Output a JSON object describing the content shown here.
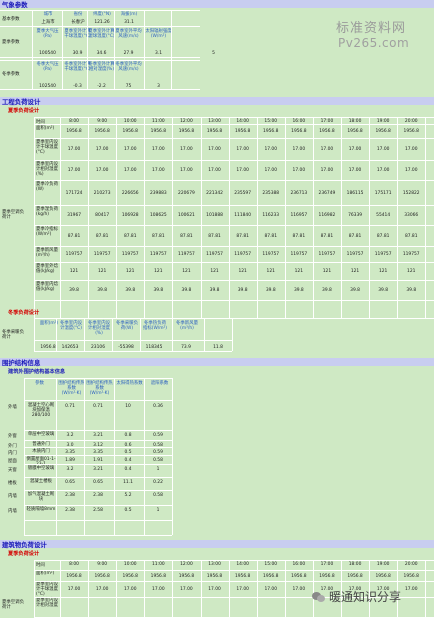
{
  "watermark": {
    "line1": "标准资料网",
    "line2": "Pv265.com"
  },
  "weather": {
    "title": "气象参数",
    "basic_label": "基本参数",
    "basic_headers": [
      "城市",
      "省份",
      "纬度(°N)",
      "海拔(m)"
    ],
    "basic_values": [
      "上海市",
      "长春沪",
      "121.26",
      "31.1"
    ],
    "summer_label": "夏季参数",
    "summer_headers": [
      "夏季大气压(Pa)",
      "夏季室外计算干球温度(°C)",
      "夏季室外计算湿球温度(°C)",
      "夏季室外平均风速(m/s)",
      "太阳辐射强度(W/m²)"
    ],
    "summer_values": [
      "100540",
      "30.9",
      "34.6",
      "27.9",
      "3.1",
      "5"
    ],
    "winter_label": "冬季参数",
    "winter_headers": [
      "冬季大气压(Pa)",
      "冬季室外计算干球温度(°C)",
      "冬季室外计算相对湿度(%)",
      "冬季室外平均风速(m/s)"
    ],
    "winter_values": [
      "102540",
      "-0.3",
      "-2.2",
      "75",
      "3"
    ]
  },
  "engineering": {
    "title": "工程负荷设计",
    "summer_sub": "夏季负荷设计",
    "time_label": "时间",
    "hours": [
      "8:00",
      "9:00",
      "10:00",
      "11:00",
      "12:00",
      "13:00",
      "14:00",
      "15:00",
      "16:00",
      "17:00",
      "18:00",
      "19:00",
      "20:00"
    ],
    "group_label": "夏季空调负荷计",
    "rows": [
      {
        "label": "面积(m²)",
        "values": [
          "1956.8",
          "1956.8",
          "1956.8",
          "1956.8",
          "1956.8",
          "1956.8",
          "1956.8",
          "1956.8",
          "1956.8",
          "1956.8",
          "1956.8",
          "1956.8",
          "1956.8"
        ]
      },
      {
        "label": "夏季室内设计干球温度(°C)",
        "values": [
          "17.00",
          "17.00",
          "17.00",
          "17.00",
          "17.00",
          "17.00",
          "17.00",
          "17.00",
          "17.00",
          "17.00",
          "17.00",
          "17.00",
          "17.00"
        ]
      },
      {
        "label": "夏季室内设计相对湿度(%)",
        "values": [
          "17.00",
          "17.00",
          "17.00",
          "17.00",
          "17.00",
          "17.00",
          "17.00",
          "17.00",
          "17.00",
          "17.00",
          "17.00",
          "17.00",
          "17.00"
        ]
      },
      {
        "label": "夏季冷负荷(W)",
        "values": [
          "171724",
          "210273",
          "226656",
          "239883",
          "220679",
          "221342",
          "235597",
          "235388",
          "236713",
          "236749",
          "186115",
          "175171",
          "152822"
        ]
      },
      {
        "label": "夏季湿负荷(kg/h)",
        "values": [
          "31967",
          "80417",
          "106928",
          "108625",
          "100621",
          "101888",
          "111840",
          "116233",
          "116957",
          "116982",
          "76339",
          "55414",
          "33066"
        ]
      },
      {
        "label": "夏季冷指标(W/m²)",
        "values": [
          "87.81",
          "87.81",
          "87.81",
          "87.81",
          "87.81",
          "87.81",
          "87.81",
          "87.81",
          "87.81",
          "87.81",
          "87.81",
          "87.81",
          "87.81"
        ]
      },
      {
        "label": "夏季新风量(m³/h)",
        "values": [
          "119757",
          "119757",
          "119757",
          "119757",
          "119757",
          "119757",
          "119757",
          "119757",
          "119757",
          "119757",
          "119757",
          "119757",
          "119757"
        ]
      },
      {
        "label": "夏季室外焓值(kJ/kg)",
        "values": [
          "121",
          "121",
          "121",
          "121",
          "121",
          "121",
          "121",
          "121",
          "121",
          "121",
          "121",
          "121",
          "121"
        ]
      },
      {
        "label": "夏季室内焓值(kJ/kg)",
        "values": [
          "39.8",
          "39.8",
          "39.8",
          "39.8",
          "39.8",
          "39.8",
          "39.8",
          "39.8",
          "39.8",
          "39.8",
          "39.8",
          "39.8",
          "39.8"
        ]
      }
    ],
    "winter_sub": "冬季负荷设计",
    "winter_group_label": "冬季采暖负荷计",
    "winter_headers": [
      "面积(m²)",
      "冬季室内设计温度(°C)",
      "冬季室内设计相对湿度(%)",
      "冬季采暖负荷(W)",
      "冬季热负荷指标(W/m²)",
      "冬季新风量(m³/h)"
    ],
    "winter_values": [
      "1956.8",
      "142653",
      "23106",
      "-55398",
      "118345",
      "73.9",
      "11.8"
    ]
  },
  "envelope": {
    "title": "围护结构信息",
    "sub": "建筑外围护结构基本信息",
    "headers": [
      "参数",
      "围护结构传热系数(W/m²·K)",
      "围护结构传热系数(W/m²·K)",
      "太阳得热系数",
      "遮阳系数"
    ],
    "rows": [
      {
        "group": "外墙",
        "name": "混凝土空心砌块加保温280/100",
        "v": [
          "0.71",
          "0.71",
          "10",
          "0.36"
        ]
      },
      {
        "group": "外窗",
        "name": "单层中空玻璃",
        "v": [
          "3.2",
          "3.21",
          "0.8",
          "0.59"
        ]
      },
      {
        "group": "外门",
        "name": "普通外门",
        "v": [
          "3.0",
          "3.12",
          "0.6",
          "0.58"
        ]
      },
      {
        "group": "内门",
        "name": "木质内门",
        "v": [
          "3.35",
          "3.35",
          "0.5",
          "0.59"
        ]
      },
      {
        "group": "屋面",
        "name": "倒置屋面01-1-23-1",
        "v": [
          "1.89",
          "1.91",
          "0.4",
          "0.58"
        ]
      },
      {
        "group": "天窗",
        "name": "镀膜中空玻璃",
        "v": [
          "3.2",
          "3.21",
          "0.4",
          "1"
        ]
      },
      {
        "group": "楼板",
        "name": "混凝土楼板",
        "v": [
          "0.65",
          "0.65",
          "11.1",
          "0.22"
        ]
      },
      {
        "group": "内墙",
        "name": "加气混凝土砌块",
        "v": [
          "2.38",
          "2.38",
          "5.2",
          "0.58"
        ]
      },
      {
        "group": "内墙",
        "name": "轻质隔墙8mm",
        "v": [
          "2.38",
          "2.58",
          "0.5",
          "1"
        ]
      }
    ]
  },
  "building": {
    "title": "建筑物负荷设计",
    "sub": "夏季负荷设计",
    "time_label": "时间",
    "hours": [
      "8:00",
      "9:00",
      "10:00",
      "11:00",
      "12:00",
      "13:00",
      "14:00",
      "15:00",
      "16:00",
      "17:00",
      "18:00",
      "19:00",
      "20:00"
    ],
    "group_label": "夏季空调负荷计",
    "rows": [
      {
        "label": "面积(m²)",
        "values": [
          "1956.8",
          "1956.8",
          "1956.8",
          "1956.8",
          "1956.8",
          "1956.8",
          "1956.8",
          "1956.8",
          "1956.8",
          "1956.8",
          "1956.8",
          "1956.8",
          "1956.8"
        ]
      },
      {
        "label": "夏季室内设计干球温度(°C)",
        "values": [
          "17.00",
          "17.00",
          "17.00",
          "17.00",
          "17.00",
          "17.00",
          "17.00",
          "17.00",
          "17.00",
          "17.00",
          "17.00",
          "17.00",
          "17.00"
        ]
      },
      {
        "label": "夏季室内设计相对湿度",
        "values": [
          "",
          "",
          "",
          "",
          "",
          "",
          "",
          "",
          "",
          "",
          "",
          "",
          ""
        ]
      }
    ]
  },
  "footer_badge": "暖通知识分享"
}
